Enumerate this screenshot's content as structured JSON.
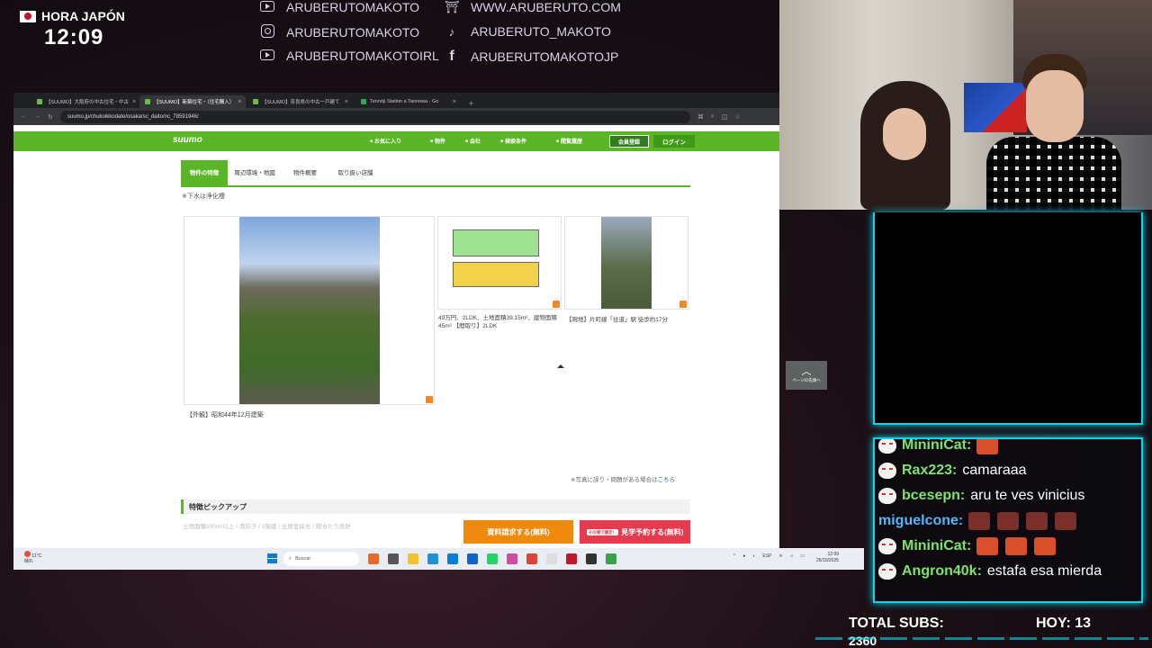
{
  "overlay": {
    "jp_label": "HORA JAPÓN",
    "jp_time": "12:09",
    "socials": [
      {
        "icon": "youtube-icon",
        "text": "ARUBERUTOMAKOTO"
      },
      {
        "icon": "instagram-icon",
        "text": "ARUBERUTOMAKOTO"
      },
      {
        "icon": "youtube-icon",
        "text": "ARUBERUTOMAKOTOIRL"
      },
      {
        "icon": "torii-gate-icon",
        "text": "WWW.ARUBERUTO.COM"
      },
      {
        "icon": "tiktok-icon",
        "text": "ARUBERUTO_MAKOTO"
      },
      {
        "icon": "facebook-icon",
        "text": "ARUBERUTOMAKOTOJP"
      }
    ],
    "accent": "#15d2e8"
  },
  "browser": {
    "tabs": [
      {
        "title": "【SUUMO】大阪府の中古住宅・中古"
      },
      {
        "title": "【SUUMO】新築住宅・（住宅購入）"
      },
      {
        "title": "【SUUMO】奈良県の中古一戸建て"
      },
      {
        "title": "Tennōji Station a Tannowa - Go"
      }
    ],
    "url": "suumo.jp/chukoikkodate/osaka/sc_daito/nc_78591946/",
    "nav": {
      "logo": "suumo",
      "links": [
        "お気に入り",
        "物件",
        "会社",
        "検索条件",
        "閲覧履歴"
      ],
      "member": "会員登録",
      "login": "ログイン"
    },
    "subtabs": [
      "物件の特徴",
      "周辺環境・地図",
      "物件概要",
      "取り扱い店舗"
    ],
    "sewage_note": "※下水は浄化槽",
    "photos": {
      "main_caption": "【外観】昭和44年12月建築",
      "plan_caption": "49万円、2LDK、土地面積39.15m²、建物面積45m² 【間取り】2LDK",
      "site_caption": "【現地】片町線「住道」駅 徒歩約17分"
    },
    "photo_note": "※写真に誤り・問題がある場合は",
    "photo_note_link": "こちら",
    "page_top": "ページの先頭へ",
    "pickup_title": "特徴ピックアップ",
    "faded_text": "土地面積100m²以上 / 南向き / 2階建 / 全居室採光 / 陽当たり良好",
    "btn_docs": "資料請求する(無料)",
    "btn_visit_badge": "その場で確定！",
    "btn_visit": "見学予約する(無料)",
    "brand_green": "#5ab626"
  },
  "taskbar": {
    "weather_temp": "11°C",
    "weather_desc": "晴れ",
    "search_placeholder": "Buscar",
    "lang": "ESP",
    "time": "12:09",
    "date": "26/10/2025"
  },
  "chat": [
    {
      "user": "MininiCat:",
      "text": "",
      "emotes": 1,
      "color": "green"
    },
    {
      "user": "Rax223:",
      "text": "camaraaa",
      "emotes": 0,
      "color": "green"
    },
    {
      "user": "bcesepn:",
      "text": "aru te ves vinicius",
      "emotes": 0,
      "color": "green"
    },
    {
      "user": "miguelcone:",
      "text": "",
      "emotes": 4,
      "color": "blue"
    },
    {
      "user": "MininiCat:",
      "text": "",
      "emotes": 3,
      "color": "green"
    },
    {
      "user": "Angron40k:",
      "text": "estafa esa mierda",
      "emotes": 0,
      "color": "green"
    }
  ],
  "subs": {
    "total_label": "TOTAL SUBS:",
    "total_value": "2360",
    "today_label": "HOY: 13"
  }
}
